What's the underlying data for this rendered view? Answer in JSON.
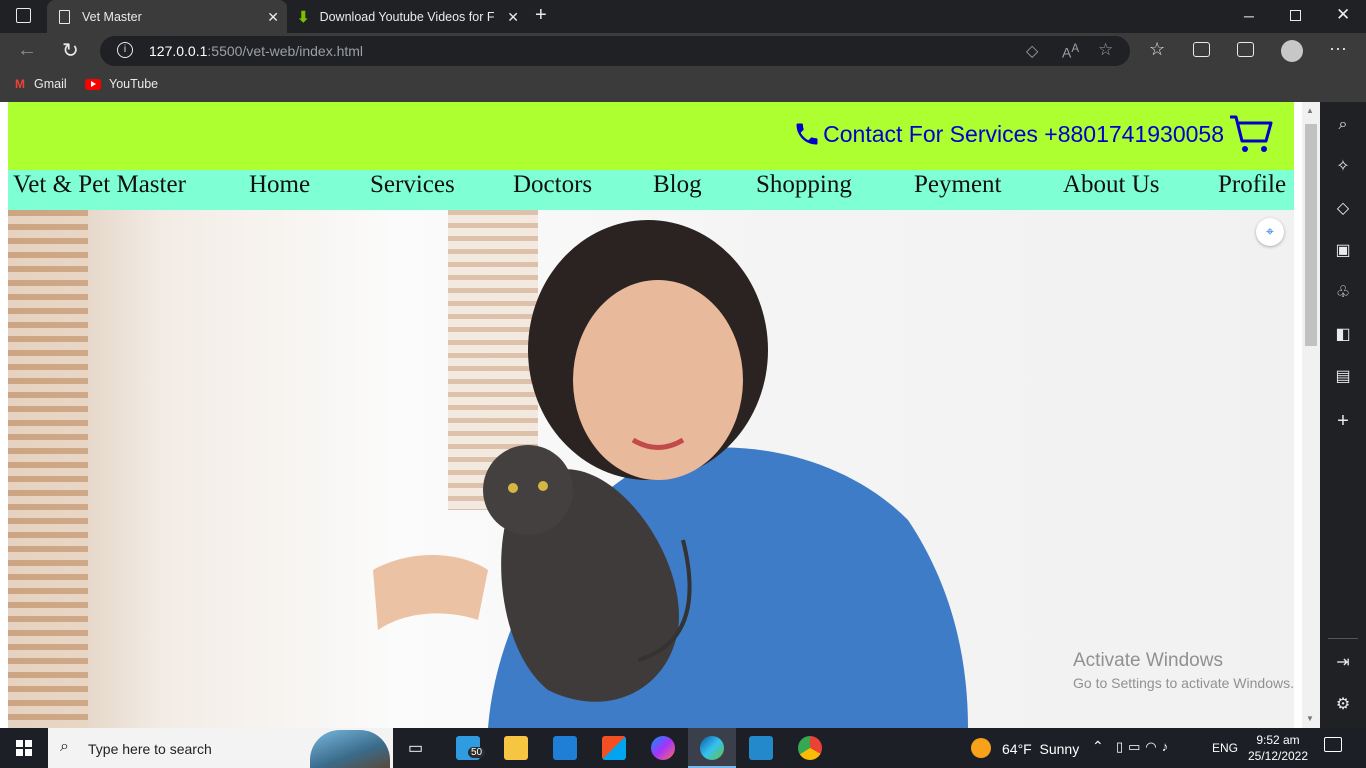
{
  "browser": {
    "tabs": [
      {
        "title": "Vet Master"
      },
      {
        "title": "Download Youtube Videos for Fr"
      }
    ],
    "url_host": "127.0.0.1",
    "url_rest": ":5500/vet-web/index.html",
    "bookmarks": [
      {
        "label": "Gmail"
      },
      {
        "label": "YouTube"
      }
    ]
  },
  "site": {
    "contact_text": "Contact For Services +8801741930058",
    "brand": "Vet & Pet Master",
    "menu": [
      {
        "label": "Home"
      },
      {
        "label": "Services"
      },
      {
        "label": "Doctors"
      },
      {
        "label": "Blog"
      },
      {
        "label": "Shopping"
      },
      {
        "label": "Peyment"
      },
      {
        "label": "About Us"
      },
      {
        "label": "Profile"
      }
    ],
    "colors": {
      "topbar": "#adff2f",
      "menubar": "#7fffd4",
      "contact": "#0000cd"
    }
  },
  "watermark": {
    "title": "Activate Windows",
    "subtitle": "Go to Settings to activate Windows."
  },
  "taskbar": {
    "search_placeholder": "Type here to search",
    "badge": "50",
    "weather": "64°F  Sunny",
    "lang": "ENG",
    "time": "9:52 am",
    "date": "25/12/2022"
  }
}
